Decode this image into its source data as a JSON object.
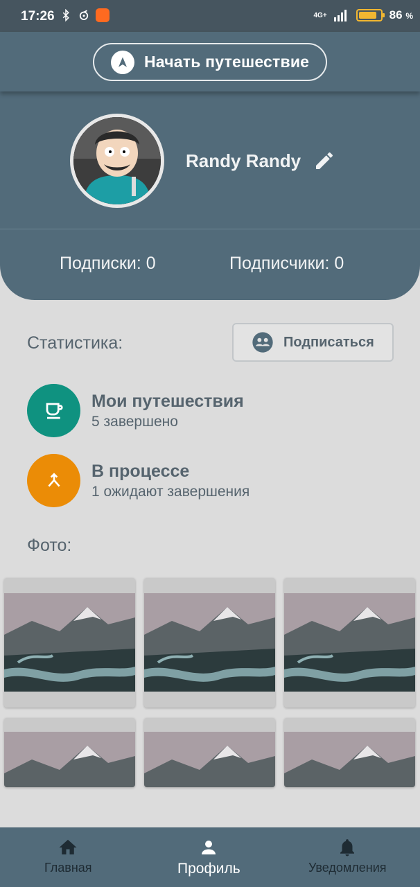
{
  "status_bar": {
    "time": "17:26",
    "network": "4G+",
    "battery_percent": "86",
    "battery_level": 0.86,
    "accent": "#f2b731"
  },
  "header": {
    "start_trip_label": "Начать путешествие",
    "start_trip_icon": "navigation-arrow-icon",
    "username": "Randy Randy",
    "edit_icon": "pencil-icon",
    "follows_label": "Подписки: 0",
    "followers_label": "Подписчики: 0",
    "background": "#526b7a"
  },
  "stats": {
    "title": "Статистика:",
    "subscribe_label": "Подписаться",
    "items": [
      {
        "title": "Мои путешествия",
        "subtitle": "5 завершено",
        "icon": "coffee-cup-icon",
        "color": "#0f9280"
      },
      {
        "title": "В процессе",
        "subtitle": "1 ожидают завершения",
        "icon": "merge-icon",
        "color": "#eb8c06"
      }
    ]
  },
  "photos": {
    "label": "Фото:",
    "count_visible": 6
  },
  "bottom_nav": {
    "items": [
      {
        "label": "Главная",
        "icon": "home-icon",
        "active": false
      },
      {
        "label": "Профиль",
        "icon": "person-icon",
        "active": true
      },
      {
        "label": "Уведомления",
        "icon": "bell-icon",
        "active": false
      }
    ]
  }
}
